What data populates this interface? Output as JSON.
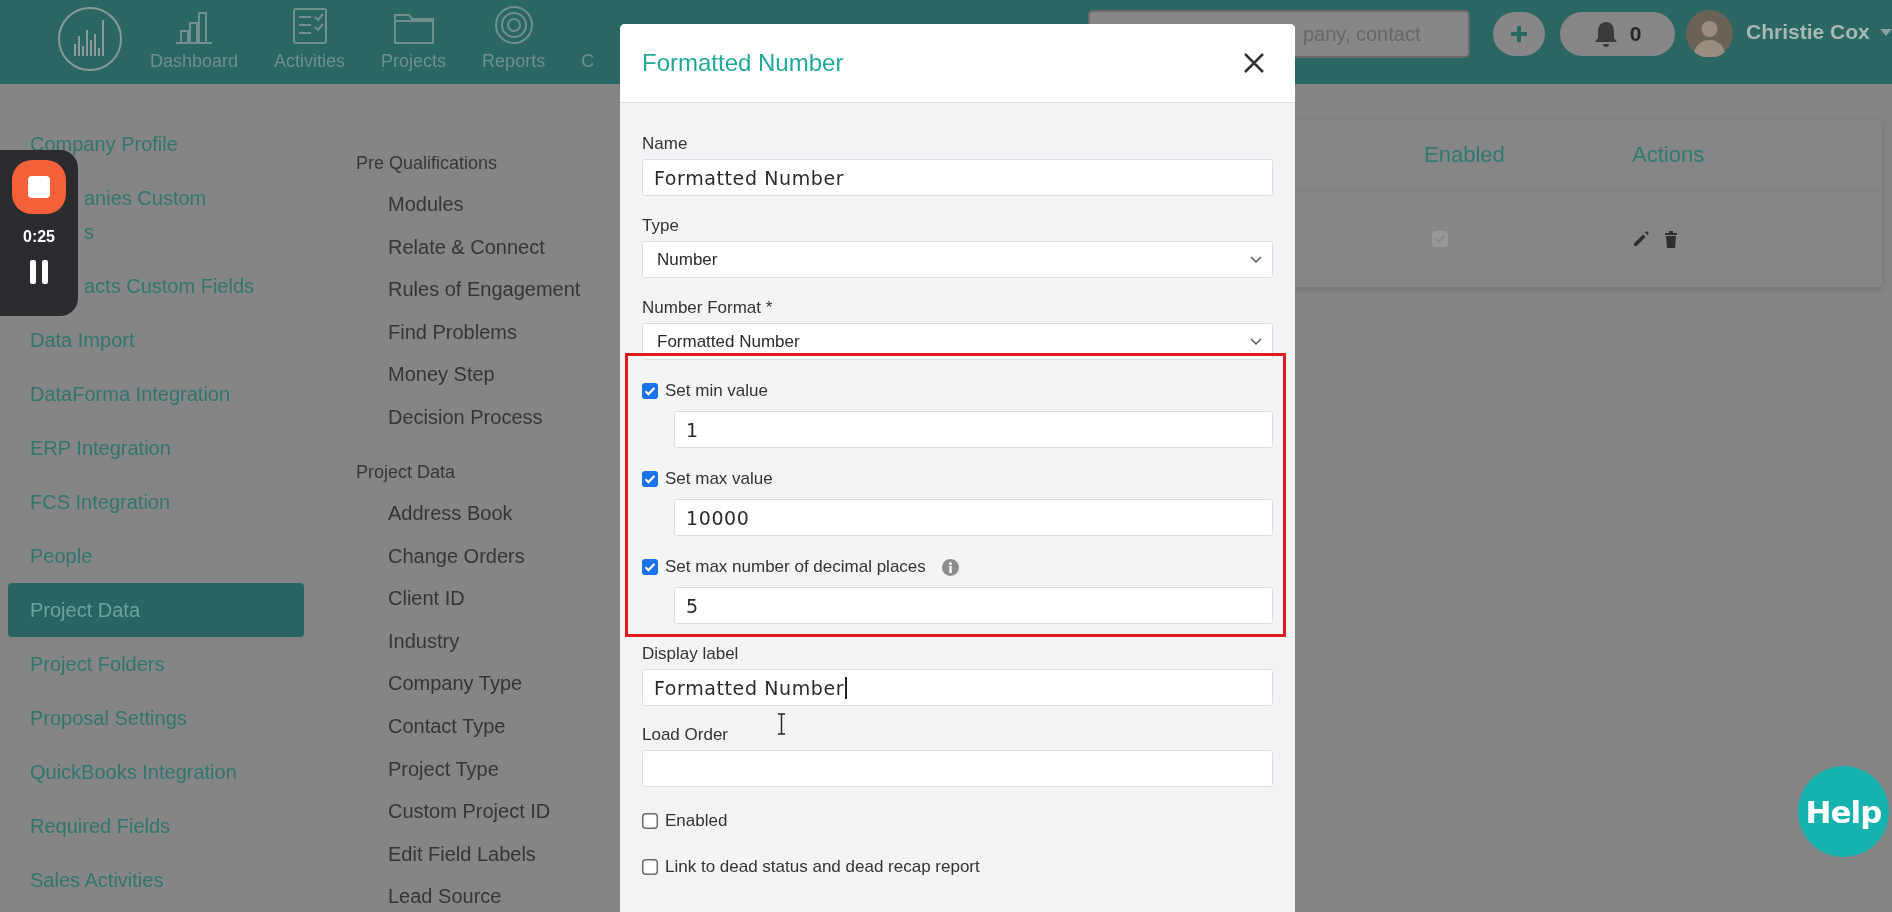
{
  "nav": {
    "items": [
      "Dashboard",
      "Activities",
      "Projects",
      "Reports",
      "C"
    ]
  },
  "search": {
    "placeholder": "pany, contact"
  },
  "notifications": {
    "count": "0"
  },
  "user": {
    "name": "Christie Cox"
  },
  "sidebar": {
    "items": [
      {
        "label": "Company Profile",
        "selected": false
      },
      {
        "label": "anies Custom",
        "second_line": "s",
        "selected": false,
        "partly_hidden": true
      },
      {
        "label": "acts Custom Fields",
        "selected": false,
        "partly_hidden": true
      },
      {
        "label": "Data Import",
        "selected": false
      },
      {
        "label": "DataForma Integration",
        "selected": false
      },
      {
        "label": "ERP Integration",
        "selected": false
      },
      {
        "label": "FCS Integration",
        "selected": false
      },
      {
        "label": "People",
        "selected": false
      },
      {
        "label": "Project Data",
        "selected": true
      },
      {
        "label": "Project Folders",
        "selected": false
      },
      {
        "label": "Proposal Settings",
        "selected": false
      },
      {
        "label": "QuickBooks Integration",
        "selected": false
      },
      {
        "label": "Required Fields",
        "selected": false
      },
      {
        "label": "Sales Activities",
        "selected": false
      }
    ]
  },
  "menu": {
    "groups": [
      {
        "title": "Pre Qualifications",
        "items": [
          "Modules",
          "Relate & Connect",
          "Rules of Engagement",
          "Find Problems",
          "Money Step",
          "Decision Process"
        ]
      },
      {
        "title": "Project Data",
        "items": [
          "Address Book",
          "Change Orders",
          "Client ID",
          "Industry",
          "Company Type",
          "Contact Type",
          "Project Type",
          "Custom Project ID",
          "Edit Field Labels",
          "Lead Source"
        ]
      }
    ]
  },
  "table": {
    "columns": [
      "Enabled",
      "Actions"
    ],
    "rows": [
      {
        "enabled": true
      }
    ]
  },
  "recorder": {
    "time": "0:25"
  },
  "help": {
    "label": "Help"
  },
  "modal": {
    "title": "Formatted Number",
    "fields": [
      {
        "kind": "text",
        "label": "Name",
        "value": "Formatted Number"
      },
      {
        "kind": "select",
        "label": "Type",
        "value": "Number"
      },
      {
        "kind": "select",
        "label": "Number Format *",
        "value": "Formatted Number"
      }
    ],
    "highlighted": [
      {
        "label": "Set min value",
        "checked": true,
        "value": "1"
      },
      {
        "label": "Set max value",
        "checked": true,
        "value": "10000"
      },
      {
        "label": "Set max number of decimal places",
        "checked": true,
        "info": true,
        "value": "5"
      }
    ],
    "more_fields": [
      {
        "kind": "text",
        "label": "Display label",
        "value": "Formatted Number",
        "focused": true
      },
      {
        "kind": "text",
        "label": "Load Order"
      },
      {
        "kind": "checkbox",
        "label": "Enabled",
        "checked": false
      },
      {
        "kind": "checkbox",
        "label": "Link to dead status and dead recap report",
        "checked": false
      }
    ]
  }
}
